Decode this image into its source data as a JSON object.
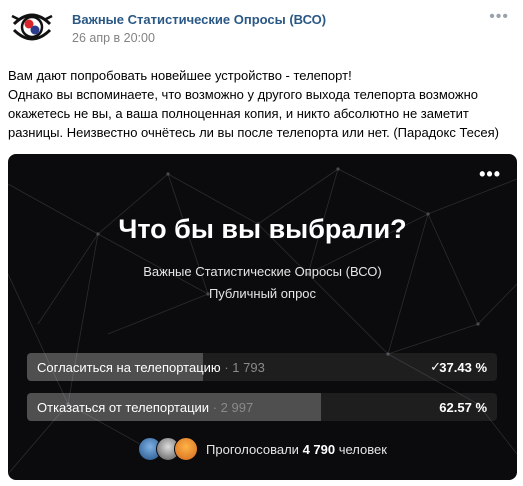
{
  "post": {
    "author": "Важные Статистические Опросы (ВСО)",
    "date": "26 апр в 20:00",
    "more": "•••",
    "text": [
      "Вам дают попробовать новейшее устройство - телепорт!",
      "Однако вы вспоминаете, что возможно у другого выхода телепорта возможно окажетесь не вы, а ваша полноценная копия, и никто абсолютно не заметит разницы. Неизвестно очнётесь ли вы после телепорта или нет. (Парадокс Тесея)"
    ]
  },
  "poll": {
    "more": "•••",
    "title": "Что бы вы выбрали?",
    "author": "Важные Статистические Опросы (ВСО)",
    "type": "Публичный опрос",
    "options": [
      {
        "label": "Согласиться на телепортацию",
        "count": "1 793",
        "percent": "37.43 %",
        "share": 0.3743,
        "selected": true
      },
      {
        "label": "Отказаться от телепортации",
        "count": "2 997",
        "percent": "62.57 %",
        "share": 0.6257,
        "selected": false
      }
    ],
    "voters_prefix": "Проголосовали",
    "voters_count": "4 790",
    "voters_suffix": "человек"
  },
  "colors": {
    "link": "#2a5885",
    "poll_bg": "#0b0b0d",
    "logo_red": "#d9262b",
    "logo_blue": "#2b3c8f"
  },
  "icons": [
    "logo-eye-icon",
    "more-icon",
    "check-icon"
  ]
}
